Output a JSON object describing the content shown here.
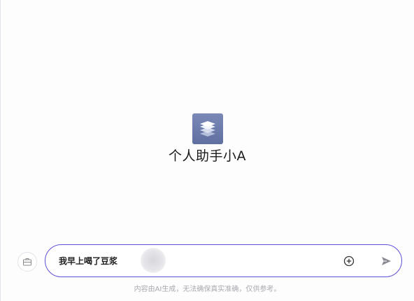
{
  "assistant": {
    "name": "个人助手小A",
    "logo_icon": "layers-stack-icon",
    "logo_color": "#6b7aab"
  },
  "composer": {
    "value": "我早上喝了豆浆",
    "border_color": "#5b4fd3",
    "side_icon": "briefcase-icon",
    "add_icon": "plus-circle-icon",
    "send_icon": "send-icon"
  },
  "footer": {
    "disclaimer": "内容由AI生成，无法确保真实准确，仅供参考。"
  }
}
